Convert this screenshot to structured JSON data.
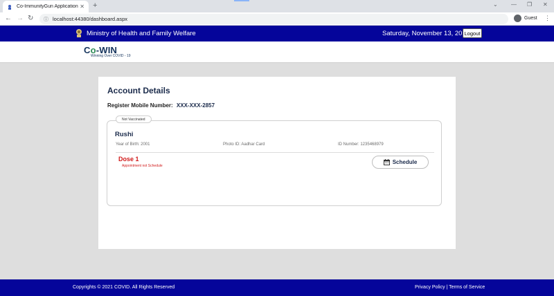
{
  "browser": {
    "tab_title": "Co-ImmunityGun Application",
    "tab_close": "✕",
    "new_tab": "+",
    "url": "localhost:44380/dashboard.aspx",
    "profile": "Guest"
  },
  "header": {
    "ministry": "Ministry of Health and Family Welfare",
    "date": "Saturday, November 13, 2021",
    "logout_label": "Logout"
  },
  "brand": {
    "logo_prefix": "C",
    "logo_o": "o",
    "logo_suffix": "-WIN",
    "tagline": "Winning Over COVID - 19"
  },
  "account": {
    "title": "Account Details",
    "mobile_label": "Register Mobile Number:",
    "mobile_value": "XXX-XXX-2857",
    "member": {
      "status": "Not Vaccinated",
      "name": "Rushi",
      "year_of_birth": "Year of Birth: 2001",
      "photo_id": "Photo ID: Aadhar Card",
      "id_number": "ID Number: 1235468979",
      "dose_title": "Dose 1",
      "appointment_status": "Appointment not Schedule",
      "schedule_label": "Schedule"
    }
  },
  "footer": {
    "copyright": "Copyrights © 2021 COVID. All Rights Reserved",
    "links": "Privacy Policy | Terms of Service"
  },
  "colors": {
    "header_bg": "#05059a",
    "title_navy": "#1b2b4b",
    "alert_red": "#d11a1a"
  }
}
